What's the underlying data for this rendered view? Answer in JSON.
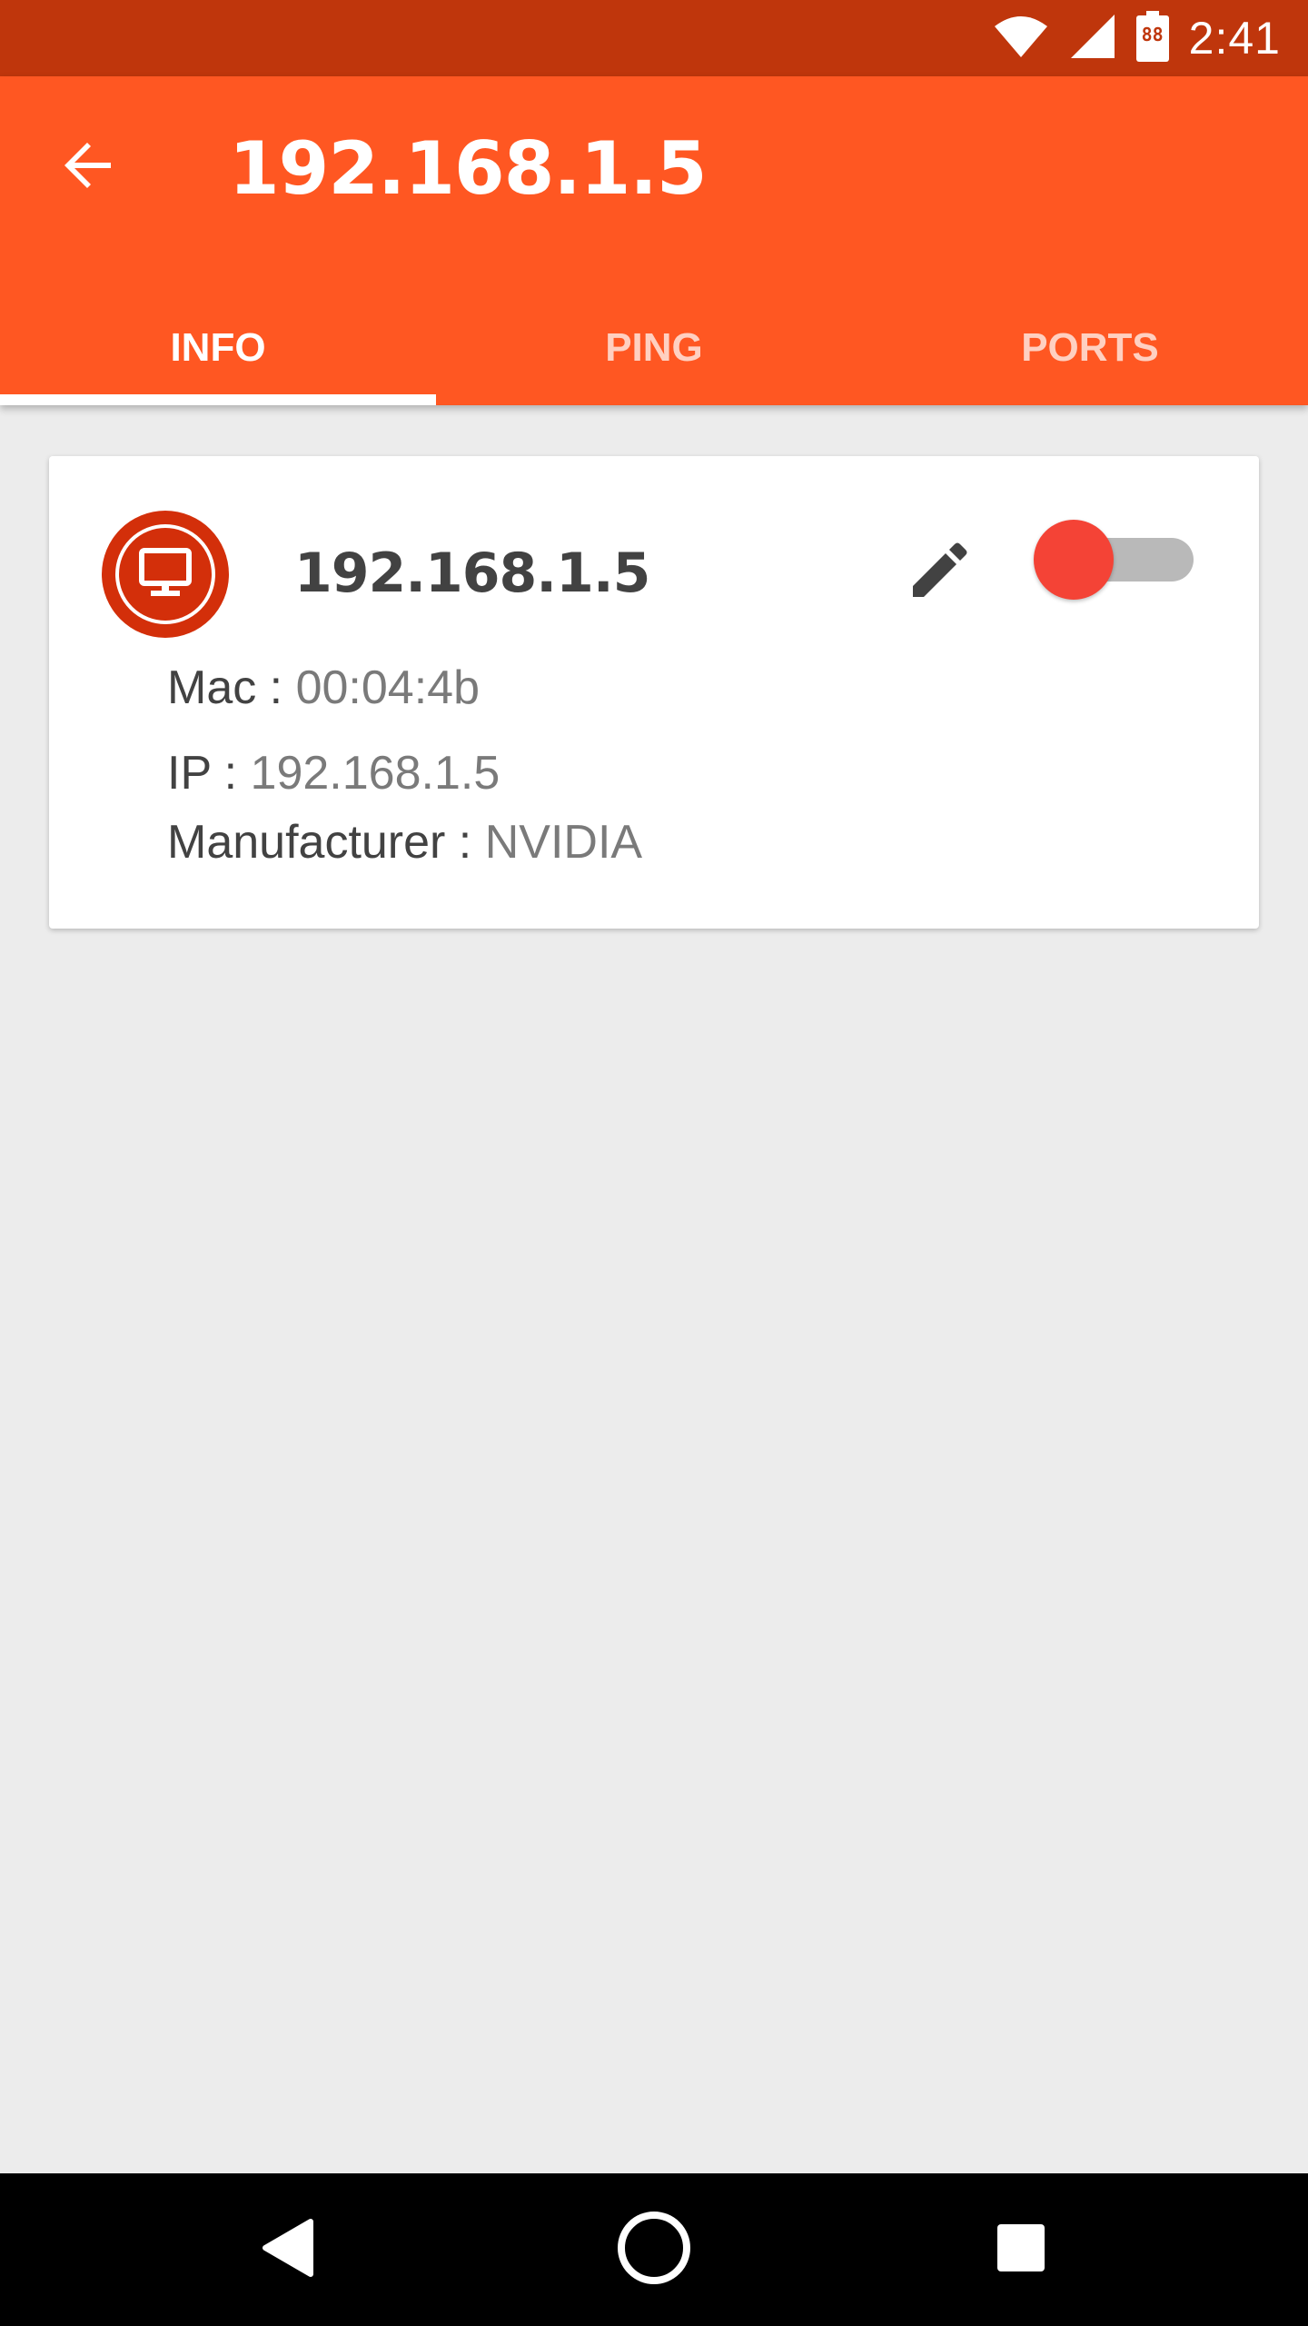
{
  "status_bar": {
    "time": "2:41",
    "battery_level": "88",
    "icons": [
      "wifi-icon",
      "cell-signal-icon",
      "battery-icon"
    ]
  },
  "app_bar": {
    "title": "192.168.1.5",
    "back_icon": "arrow-back-icon",
    "color": "#ff5722",
    "status_color": "#bf360c"
  },
  "tabs": [
    {
      "label": "INFO",
      "active": true
    },
    {
      "label": "PING",
      "active": false
    },
    {
      "label": "PORTS",
      "active": false
    }
  ],
  "device_card": {
    "title": "192.168.1.5",
    "avatar_icon": "monitor-icon",
    "edit_icon": "pencil-icon",
    "toggle_on": false,
    "toggle_thumb_color": "#f44336",
    "fields": {
      "mac": {
        "label": "Mac : ",
        "value": "00:04:4b"
      },
      "ip": {
        "label": "IP : ",
        "value": "192.168.1.5"
      },
      "manufacturer": {
        "label": "Manufacturer : ",
        "value": "NVIDIA"
      }
    }
  },
  "nav_bar": {
    "buttons": [
      "back-triangle-icon",
      "home-circle-icon",
      "recents-square-icon"
    ]
  }
}
